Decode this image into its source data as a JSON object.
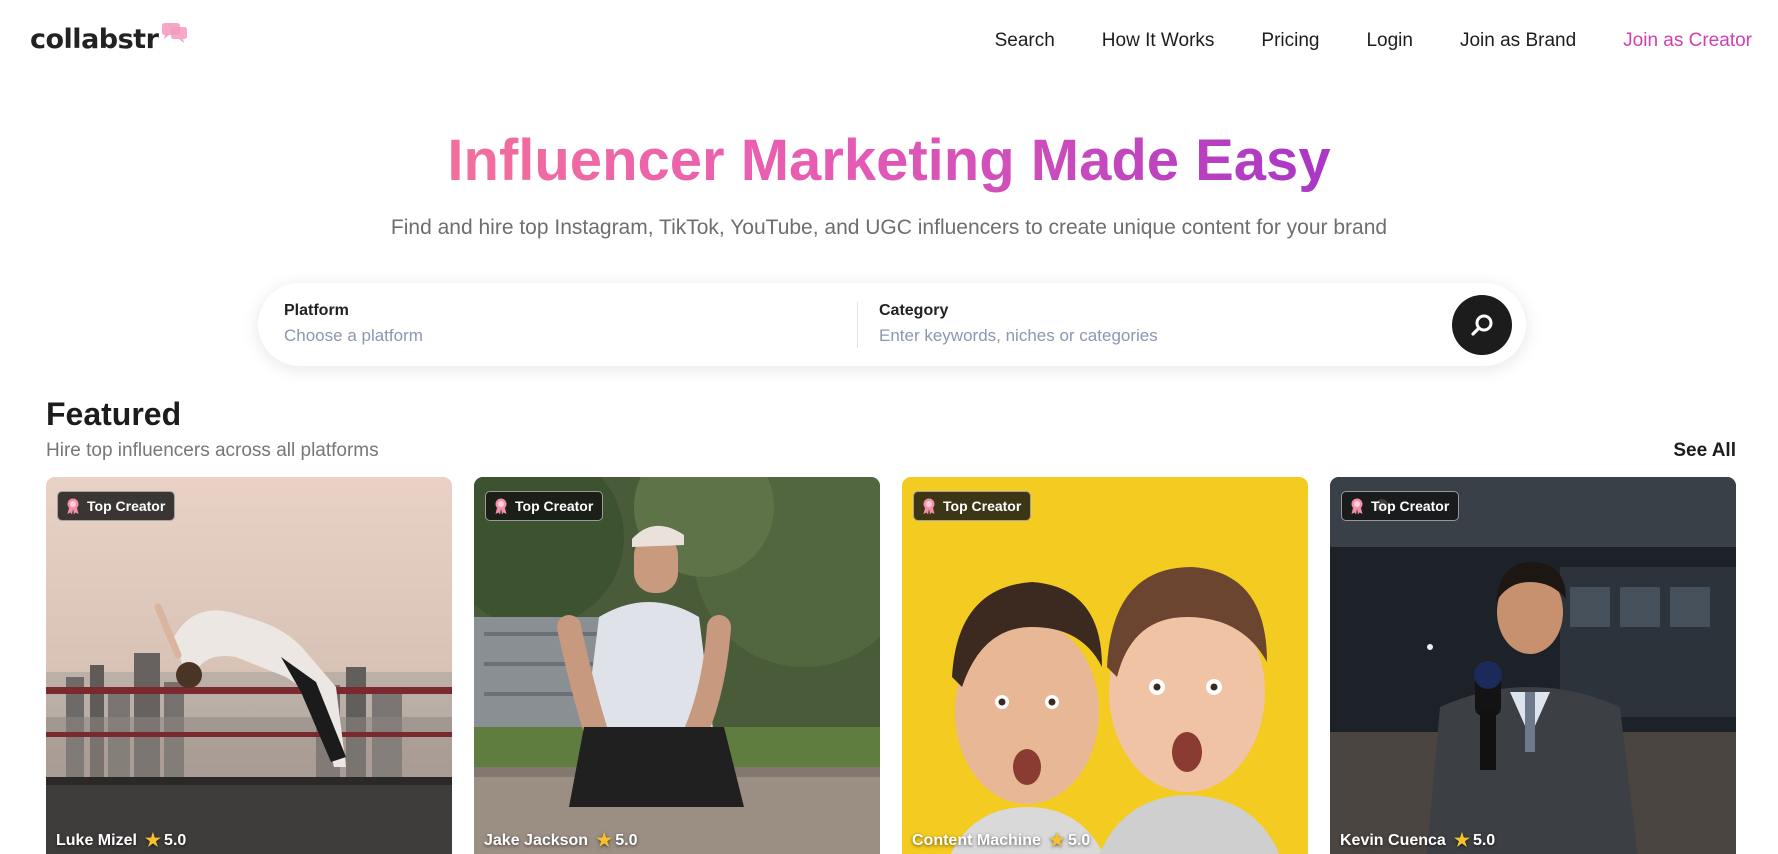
{
  "brand": {
    "name": "collabstr",
    "accent": "#f5a0c4"
  },
  "nav": [
    {
      "label": "Search"
    },
    {
      "label": "How It Works"
    },
    {
      "label": "Pricing"
    },
    {
      "label": "Login"
    },
    {
      "label": "Join as Brand"
    },
    {
      "label": "Join as Creator"
    }
  ],
  "hero": {
    "title": "Influencer Marketing Made Easy",
    "subtitle": "Find and hire top Instagram, TikTok, YouTube, and UGC influencers to create unique content for your brand"
  },
  "search": {
    "platform": {
      "label": "Platform",
      "placeholder": "Choose a platform"
    },
    "category": {
      "label": "Category",
      "placeholder": "Enter keywords, niches or categories"
    },
    "button_icon": "search-icon"
  },
  "featured": {
    "title": "Featured",
    "subtitle": "Hire top influencers across all platforms",
    "see_all": "See All",
    "cards": [
      {
        "badge": "Top Creator",
        "name": "Luke Mizel",
        "rating": "5.0"
      },
      {
        "badge": "Top Creator",
        "name": "Jake Jackson",
        "rating": "5.0"
      },
      {
        "badge": "Top Creator",
        "name": "Content Machine",
        "rating": "5.0"
      },
      {
        "badge": "Top Creator",
        "name": "Kevin Cuenca",
        "rating": "5.0"
      }
    ]
  },
  "colors": {
    "gradient_start": "#f36f9a",
    "gradient_end": "#a837c5",
    "creator_link": "#d23fb0",
    "star": "#f5c12c"
  }
}
